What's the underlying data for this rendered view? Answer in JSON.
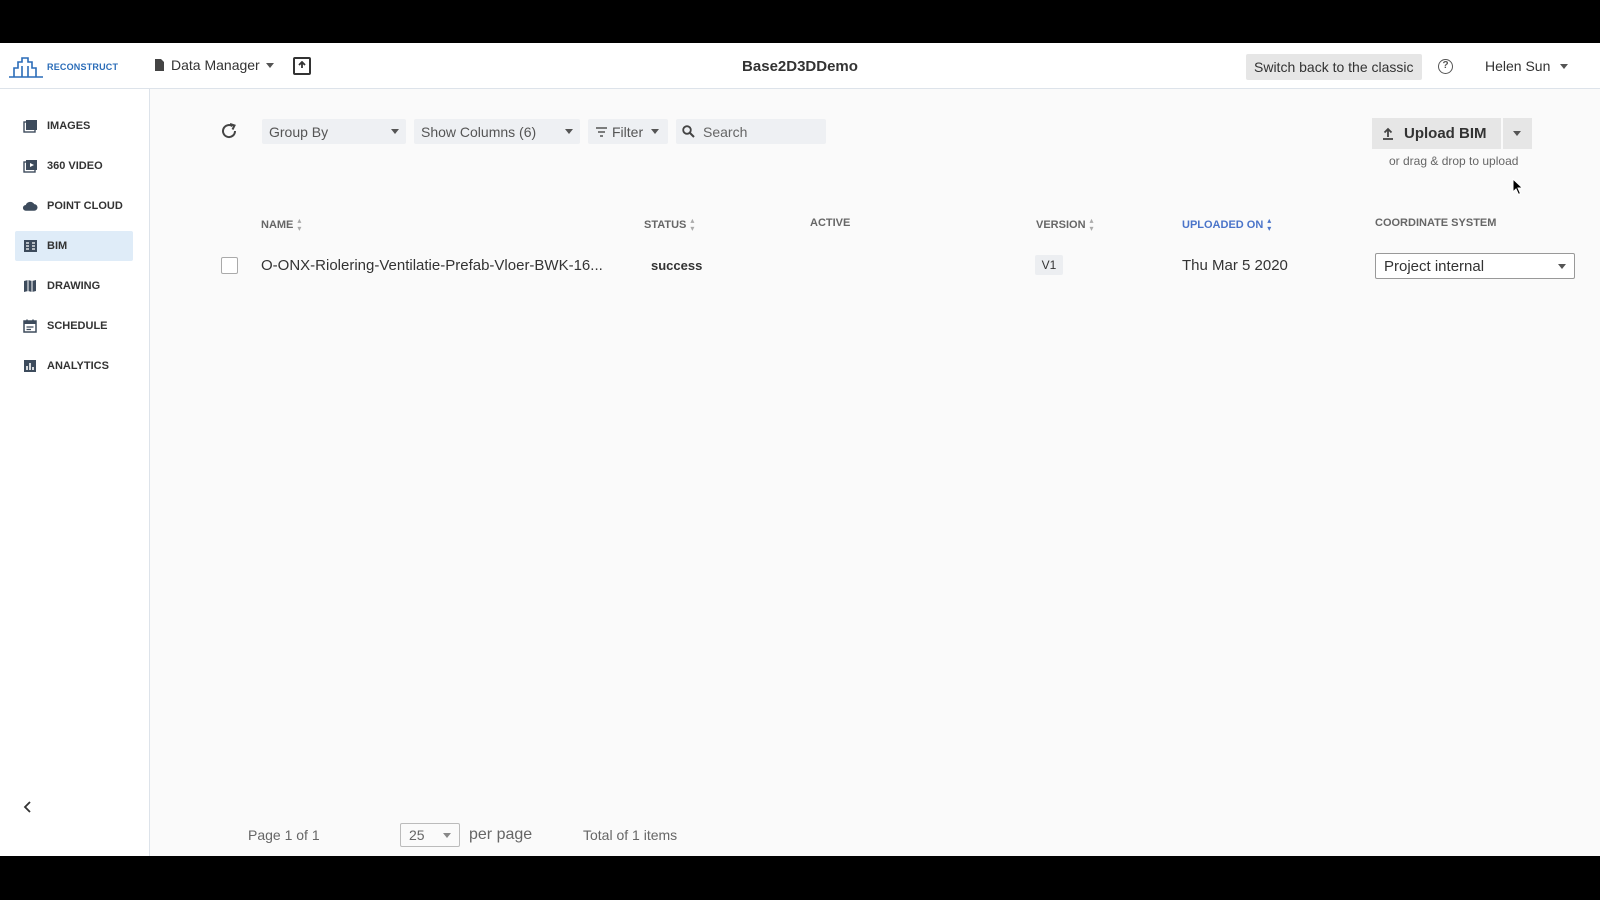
{
  "header": {
    "logo_text": "RECONSTRUCT",
    "data_manager_label": "Data Manager",
    "project_title": "Base2D3DDemo",
    "switch_classic_label": "Switch back to the classic",
    "help_icon": "question-circle-icon",
    "user_name": "Helen Sun"
  },
  "sidebar": {
    "items": [
      {
        "label": "IMAGES",
        "icon": "images-icon",
        "active": false
      },
      {
        "label": "360 VIDEO",
        "icon": "video-icon",
        "active": false
      },
      {
        "label": "POINT CLOUD",
        "icon": "cloud-icon",
        "active": false
      },
      {
        "label": "BIM",
        "icon": "building-icon",
        "active": true
      },
      {
        "label": "DRAWING",
        "icon": "map-icon",
        "active": false
      },
      {
        "label": "SCHEDULE",
        "icon": "calendar-icon",
        "active": false
      },
      {
        "label": "ANALYTICS",
        "icon": "bar-chart-icon",
        "active": false
      }
    ],
    "collapse_icon": "chevron-left-icon"
  },
  "toolbar": {
    "group_by_label": "Group By",
    "show_columns_label": "Show Columns (6)",
    "filter_label": "Filter",
    "search_placeholder": "Search",
    "upload_label": "Upload BIM",
    "drag_hint": "or drag & drop to upload"
  },
  "table": {
    "columns": [
      {
        "label": "NAME",
        "sortable": true,
        "sorted": false
      },
      {
        "label": "STATUS",
        "sortable": true,
        "sorted": false
      },
      {
        "label": "ACTIVE",
        "sortable": false,
        "sorted": false
      },
      {
        "label": "VERSION",
        "sortable": true,
        "sorted": false
      },
      {
        "label": "UPLOADED ON",
        "sortable": true,
        "sorted": true
      },
      {
        "label": "COORDINATE SYSTEM",
        "sortable": false,
        "sorted": false
      }
    ],
    "rows": [
      {
        "name": "O-ONX-Riolering-Ventilatie-Prefab-Vloer-BWK-16...",
        "status": "success",
        "active": "",
        "version": "V1",
        "uploaded_on": "Thu Mar 5 2020",
        "coordinate_system": "Project internal"
      }
    ]
  },
  "footer": {
    "page_info": "Page 1 of 1",
    "per_page_value": "25",
    "per_page_label": "per page",
    "total_info": "Total of 1 items"
  },
  "colors": {
    "accent": "#4a74c9",
    "logo": "#2a6cb8",
    "active_nav_bg": "#dfecf8"
  }
}
